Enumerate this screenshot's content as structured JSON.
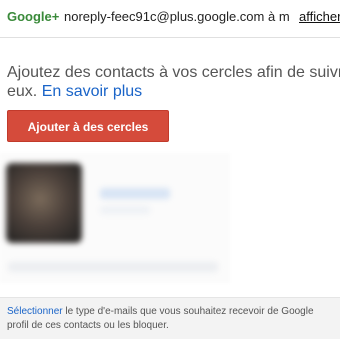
{
  "header": {
    "brand": "Google+",
    "sender": "noreply-feec91c@plus.google.com à m",
    "show_link": "afficher"
  },
  "intro": {
    "line1": "Ajoutez des contacts à vos cercles afin de suivr",
    "line2_prefix": "eux. ",
    "learn_more": "En savoir plus"
  },
  "actions": {
    "add_to_circles": "Ajouter à des cercles"
  },
  "footer": {
    "select_link": "Sélectionner",
    "line1_rest": " le type d'e-mails que vous souhaitez recevoir de Google",
    "line2": "profil de ces contacts ou les bloquer."
  }
}
